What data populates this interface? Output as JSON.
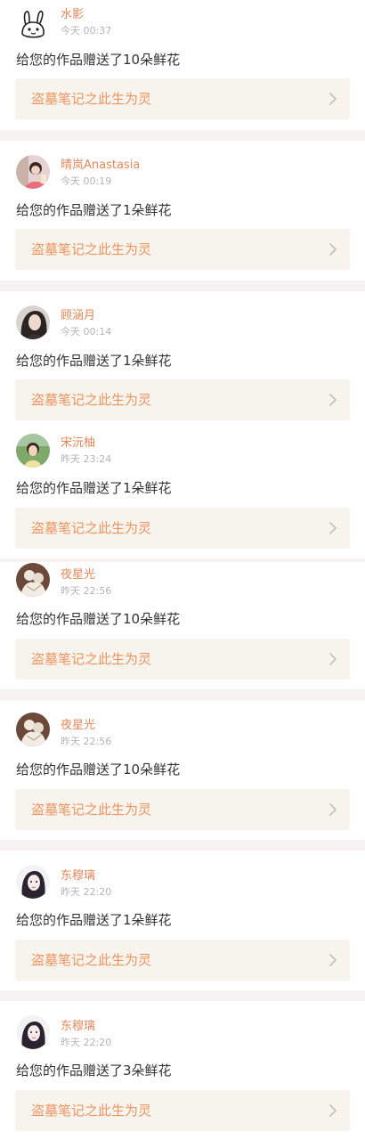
{
  "colors": {
    "name": "#e0875a",
    "time": "#b4b4b4",
    "message": "#333333",
    "work_title": "#ec9461",
    "work_bg": "#f6f4ec",
    "separator": "#f6f2f2"
  },
  "notifications": [
    {
      "user": "水影",
      "time": "今天 00:37",
      "message": "给您的作品赠送了10朵鲜花",
      "work_title": "盗墓笔记之此生为灵",
      "avatar_icon": "doodle-rabbit-avatar-icon"
    },
    {
      "user": "晴岚Anastasia",
      "time": "今天 00:19",
      "message": "给您的作品赠送了1朵鲜花",
      "work_title": "盗墓笔记之此生为灵",
      "avatar_icon": "girl-photo-avatar-icon"
    },
    {
      "user": "顾涵月",
      "time": "今天 00:14",
      "message": "给您的作品赠送了1朵鲜花",
      "work_title": "盗墓笔记之此生为灵",
      "avatar_icon": "dark-portrait-avatar-icon"
    },
    {
      "user": "宋沅柚",
      "time": "昨天 23:24",
      "message": "给您的作品赠送了1朵鲜花",
      "work_title": "盗墓笔记之此生为灵",
      "avatar_icon": "outdoor-portrait-avatar-icon"
    },
    {
      "user": "夜星光",
      "time": "昨天 22:56",
      "message": "给您的作品赠送了10朵鲜花",
      "work_title": "盗墓笔记之此生为灵",
      "avatar_icon": "statue-avatar-icon"
    },
    {
      "user": "夜星光",
      "time": "昨天 22:56",
      "message": "给您的作品赠送了10朵鲜花",
      "work_title": "盗墓笔记之此生为灵",
      "avatar_icon": "statue-avatar-icon"
    },
    {
      "user": "东穆璃",
      "time": "昨天 22:20",
      "message": "给您的作品赠送了1朵鲜花",
      "work_title": "盗墓笔记之此生为灵",
      "avatar_icon": "sketch-girl-avatar-icon"
    },
    {
      "user": "东穆璃",
      "time": "昨天 22:20",
      "message": "给您的作品赠送了3朵鲜花",
      "work_title": "盗墓笔记之此生为灵",
      "avatar_icon": "sketch-girl-avatar-icon"
    }
  ]
}
